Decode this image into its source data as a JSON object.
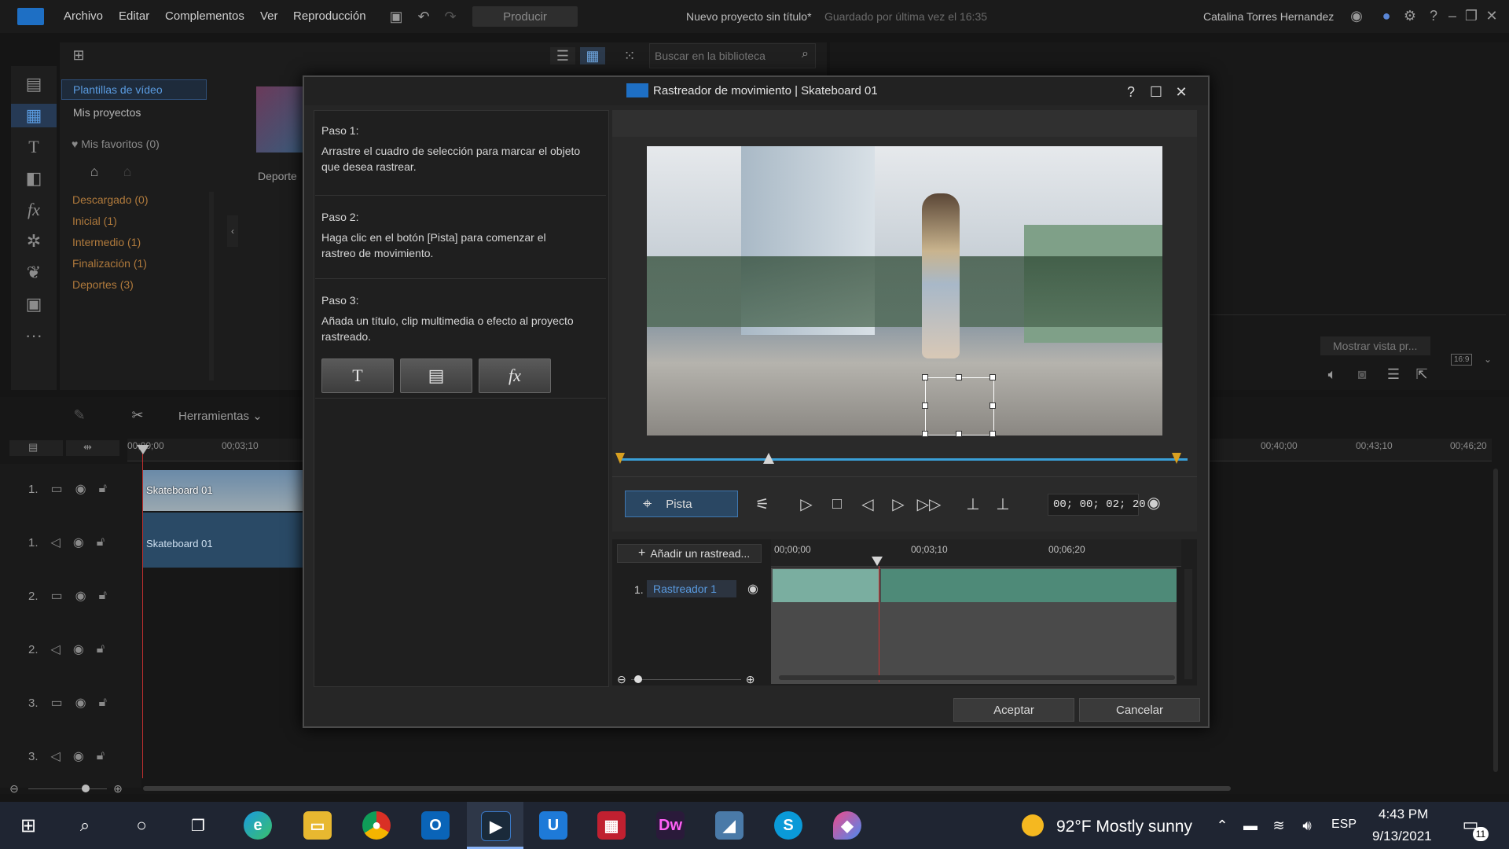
{
  "menu": {
    "items": [
      "Archivo",
      "Editar",
      "Complementos",
      "Ver",
      "Reproducción"
    ],
    "produce": "Producir",
    "project_title": "Nuevo proyecto sin título*",
    "saved_status": "Guardado por última vez el 16:35",
    "user_name": "Catalina Torres Hernandez"
  },
  "library": {
    "search_placeholder": "Buscar en la biblioteca",
    "nav": [
      "Plantillas de vídeo",
      "Mis proyectos"
    ],
    "favorites": "Mis favoritos (0)",
    "categories": [
      "Descargado  (0)",
      "Inicial  (1)",
      "Intermedio  (1)",
      "Finalización  (1)",
      "Deportes  (3)"
    ],
    "thumb_label": "Deporte"
  },
  "preview": {
    "show_preview": "Mostrar vista pr...",
    "aspect": "16:9"
  },
  "timeline": {
    "tools_label": "Herramientas",
    "ruler": [
      "00;00;00",
      "00;03;10",
      "00;40;00",
      "00;43;10",
      "00;46;20"
    ],
    "tracks": [
      "1.",
      "1.",
      "2.",
      "2.",
      "3.",
      "3."
    ],
    "clip_video": "Skateboard 01",
    "clip_audio": "Skateboard 01"
  },
  "dialog": {
    "title": "Rastreador de movimiento  |  Skateboard 01",
    "steps": [
      {
        "title": "Paso 1:",
        "text": "Arrastre el cuadro de selección para marcar el objeto que desea rastrear."
      },
      {
        "title": "Paso 2:",
        "text": "Haga clic en el botón [Pista] para comenzar el rastreo de movimiento."
      },
      {
        "title": "Paso 3:",
        "text": "Añada un título, clip multimedia o efecto al proyecto rastreado."
      }
    ],
    "tool_buttons": [
      "T",
      "▤",
      "fx"
    ],
    "track_button": "Pista",
    "timecode": "00; 00; 02; 20",
    "add_tracker": "Añadir un rastread...",
    "ruler": [
      "00;00;00",
      "00;03;10",
      "00;06;20"
    ],
    "tracker_index": "1.",
    "tracker_name": "Rastreador 1",
    "accept": "Aceptar",
    "cancel": "Cancelar"
  },
  "taskbar": {
    "weather": "92°F  Mostly sunny",
    "lang": "ESP",
    "time": "4:43 PM",
    "date": "9/13/2021",
    "notifications": "11"
  }
}
